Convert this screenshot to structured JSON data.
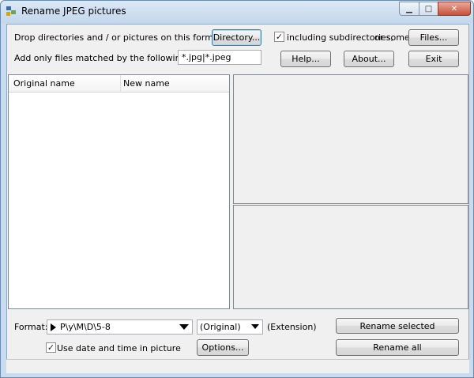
{
  "window": {
    "title": "Rename JPEG pictures",
    "controls": {
      "minimize": "▁",
      "maximize": "□",
      "close": "✕"
    }
  },
  "top": {
    "drop_text": "Drop directories and / or pictures on this form or select a",
    "directory_button": "Directory...",
    "subdirs_checked": true,
    "subdirs_label": "including subdirectories,",
    "or_some": "or some",
    "files_button": "Files...",
    "mask_label": "Add only files matched by the following mask(s) :",
    "mask_value": "*.jpg|*.jpeg",
    "help_button": "Help...",
    "about_button": "About...",
    "exit_button": "Exit"
  },
  "list": {
    "columns": [
      "Original name",
      "New name"
    ],
    "rows": []
  },
  "bottom": {
    "format_label": "Format:",
    "format_value": "P\\y\\M\\D\\5-8",
    "original_value": "(Original)",
    "extension_label": "(Extension)",
    "rename_selected_button": "Rename selected",
    "use_datetime_checked": true,
    "use_datetime_label": "Use date and time in picture",
    "options_button": "Options...",
    "rename_all_button": "Rename all"
  },
  "icons": {
    "app": "app-icon",
    "format_marker": "triangle-right-icon",
    "check": "✓"
  }
}
